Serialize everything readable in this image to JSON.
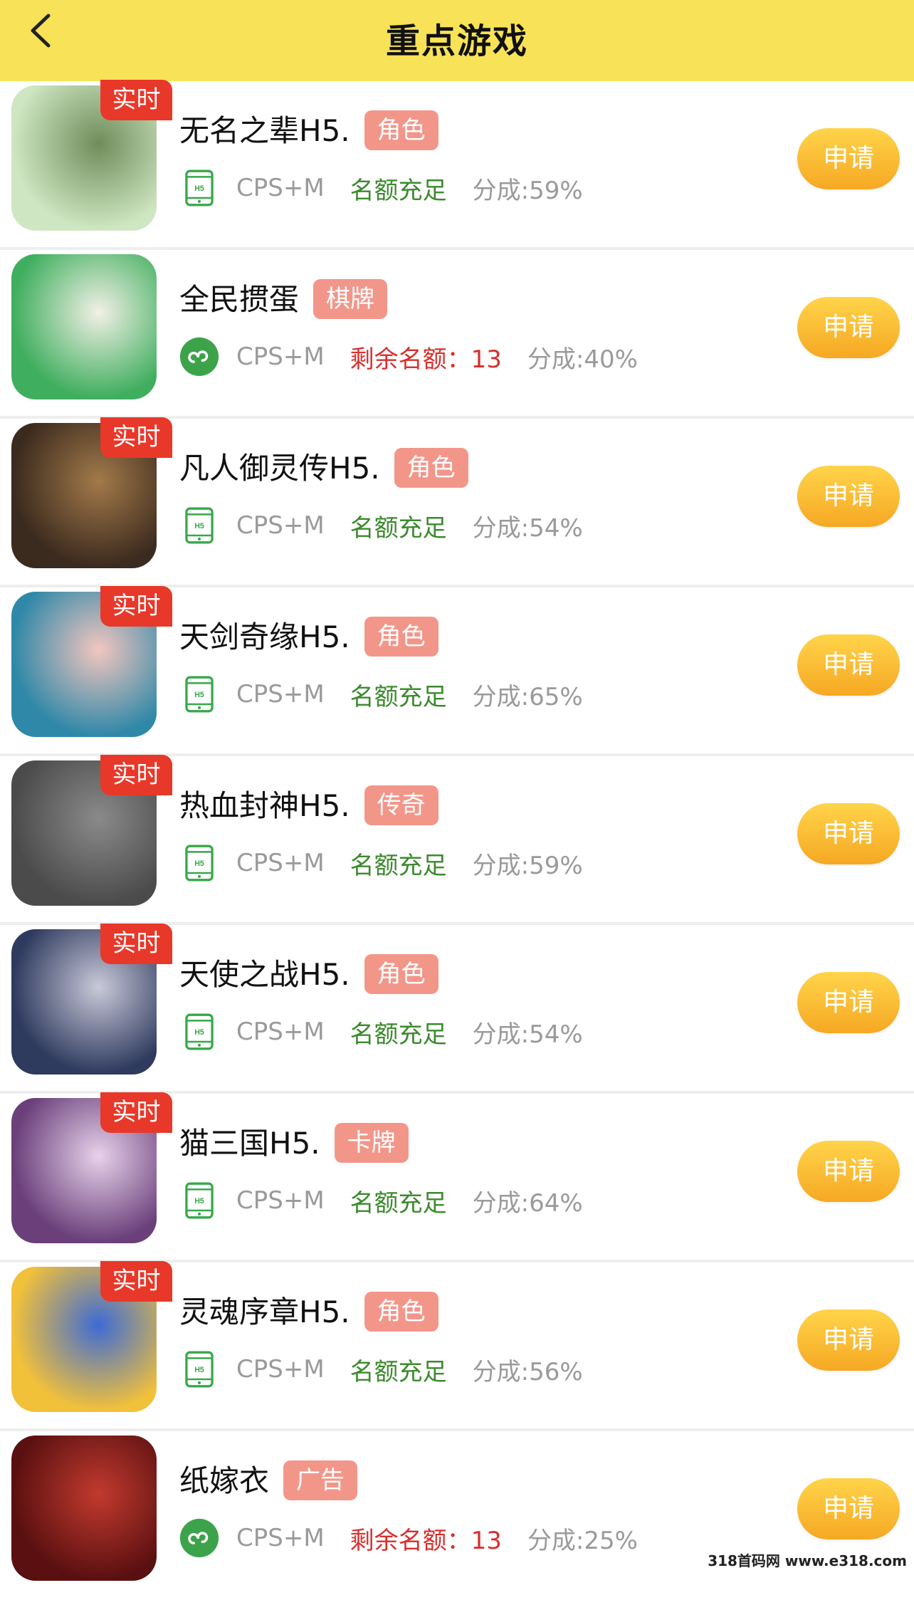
{
  "header": {
    "title": "重点游戏",
    "back_icon": "chevron-left-icon"
  },
  "accent_color": "#f8e257",
  "apply_label": "申请",
  "games": [
    {
      "name": "无名之辈H5.",
      "tag": "角色",
      "badge": "实时",
      "type_icon": "h5-phone-icon",
      "mode": "CPS+M",
      "quota": "名额充足",
      "quota_status": "ok",
      "share": "分成:59%"
    },
    {
      "name": "全民掼蛋",
      "tag": "棋牌",
      "badge": "",
      "type_icon": "mini-program-icon",
      "mode": "CPS+M",
      "quota": "剩余名额：13",
      "quota_status": "limited",
      "share": "分成:40%"
    },
    {
      "name": "凡人御灵传H5.",
      "tag": "角色",
      "badge": "实时",
      "type_icon": "h5-phone-icon",
      "mode": "CPS+M",
      "quota": "名额充足",
      "quota_status": "ok",
      "share": "分成:54%"
    },
    {
      "name": "天剑奇缘H5.",
      "tag": "角色",
      "badge": "实时",
      "type_icon": "h5-phone-icon",
      "mode": "CPS+M",
      "quota": "名额充足",
      "quota_status": "ok",
      "share": "分成:65%"
    },
    {
      "name": "热血封神H5.",
      "tag": "传奇",
      "badge": "实时",
      "type_icon": "h5-phone-icon",
      "mode": "CPS+M",
      "quota": "名额充足",
      "quota_status": "ok",
      "share": "分成:59%"
    },
    {
      "name": "天使之战H5.",
      "tag": "角色",
      "badge": "实时",
      "type_icon": "h5-phone-icon",
      "mode": "CPS+M",
      "quota": "名额充足",
      "quota_status": "ok",
      "share": "分成:54%"
    },
    {
      "name": "猫三国H5.",
      "tag": "卡牌",
      "badge": "实时",
      "type_icon": "h5-phone-icon",
      "mode": "CPS+M",
      "quota": "名额充足",
      "quota_status": "ok",
      "share": "分成:64%"
    },
    {
      "name": "灵魂序章H5.",
      "tag": "角色",
      "badge": "实时",
      "type_icon": "h5-phone-icon",
      "mode": "CPS+M",
      "quota": "名额充足",
      "quota_status": "ok",
      "share": "分成:56%"
    },
    {
      "name": "纸嫁衣",
      "tag": "广告",
      "badge": "",
      "type_icon": "mini-program-icon",
      "mode": "CPS+M",
      "quota": "剩余名额：13",
      "quota_status": "limited",
      "share": "分成:25%"
    }
  ],
  "watermark": "318首码网 www.e318.com"
}
